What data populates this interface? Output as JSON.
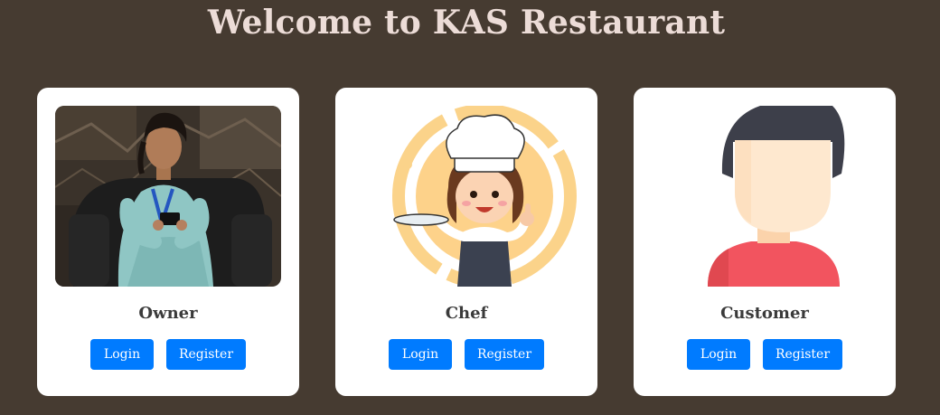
{
  "page": {
    "title": "Welcome to KAS Restaurant"
  },
  "cards": [
    {
      "role": "Owner",
      "image": "owner-photo",
      "login_label": "Login",
      "register_label": "Register"
    },
    {
      "role": "Chef",
      "image": "chef-illustration",
      "login_label": "Login",
      "register_label": "Register"
    },
    {
      "role": "Customer",
      "image": "customer-avatar",
      "login_label": "Login",
      "register_label": "Register"
    }
  ],
  "colors": {
    "background": "#463b31",
    "card": "#ffffff",
    "button": "#007bff",
    "title": "#ecdcd7"
  }
}
